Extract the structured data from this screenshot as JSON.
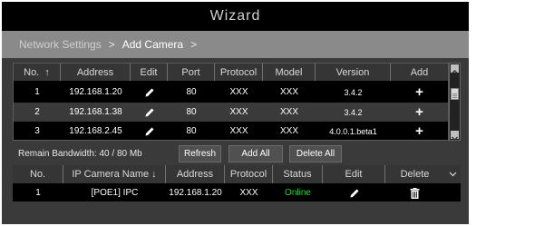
{
  "window": {
    "title": "Wizard"
  },
  "breadcrumb": {
    "items": [
      "Network Settings",
      "Add Camera"
    ],
    "separator": ">"
  },
  "search_table": {
    "headers": [
      "No.",
      "Address",
      "Edit",
      "Port",
      "Protocol",
      "Model",
      "Version",
      "Add"
    ],
    "sort_indicator": "↑",
    "rows": [
      {
        "no": "1",
        "address": "192.168.1.20",
        "port": "80",
        "protocol": "XXX",
        "model": "XXX",
        "version": "3.4.2",
        "add": "+"
      },
      {
        "no": "2",
        "address": "192.168.1.38",
        "port": "80",
        "protocol": "XXX",
        "model": "XXX",
        "version": "3.4.2",
        "add": "+"
      },
      {
        "no": "3",
        "address": "192.168.2.45",
        "port": "80",
        "protocol": "XXX",
        "model": "XXX",
        "version": "4.0.0.1.beta1",
        "add": "+"
      }
    ]
  },
  "toolbar": {
    "bandwidth": "Remain Bandwidth: 40 / 80 Mb",
    "refresh": "Refresh",
    "add_all": "Add All",
    "delete_all": "Delete All"
  },
  "added_table": {
    "headers": [
      "No.",
      "IP Camera Name",
      "Address",
      "Protocol",
      "Status",
      "Edit",
      "Delete"
    ],
    "sort_indicator": "↓",
    "rows": [
      {
        "no": "1",
        "name": "[POE1] IPC",
        "address": "192.168.1.20",
        "protocol": "XXX",
        "status": "Online"
      }
    ]
  },
  "colors": {
    "online": "#2ecc40",
    "title_bar": "#000000",
    "breadcrumb_bar": "#8a8a8a"
  }
}
